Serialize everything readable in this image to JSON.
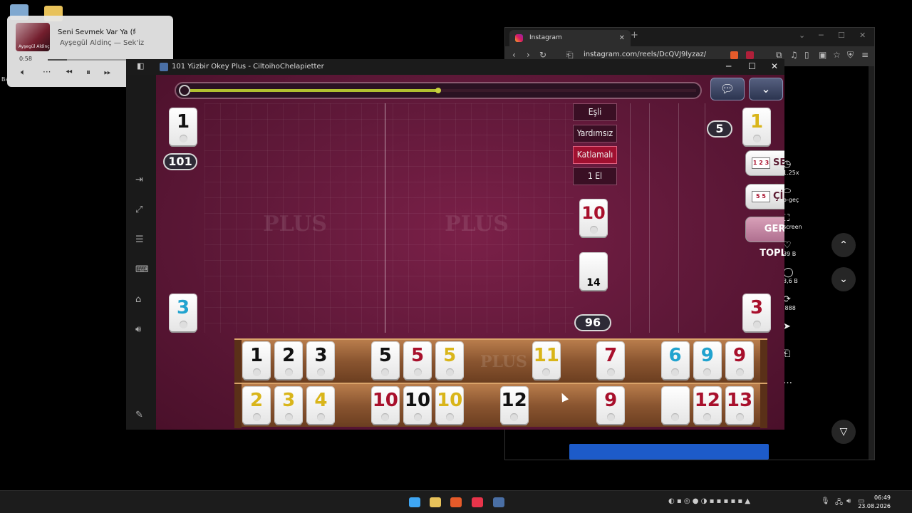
{
  "media": {
    "title": "Seni Sevmek Var Ya (fea",
    "artist": "Ayşegül Aldinç — Sek'iz",
    "art_text": "Ayşegül Aldinç",
    "elapsed": "0:58",
    "progress": 0.18
  },
  "desktop": {
    "label": "Ba"
  },
  "browser": {
    "tab_title": "Instagram",
    "url": "instagram.com/reels/DcQVJ9lyzaz/",
    "side": [
      {
        "glyph": "◷",
        "label": "1.25x"
      },
      {
        "glyph": "⬭",
        "label": "o-geç"
      },
      {
        "glyph": "⛶",
        "label": "screen"
      },
      {
        "glyph": "♡",
        "label": "39 B"
      },
      {
        "glyph": "◯",
        "label": "3,6 B"
      },
      {
        "glyph": "⟳",
        "label": ".888"
      },
      {
        "glyph": "➤",
        "label": ""
      },
      {
        "glyph": "⎗",
        "label": ""
      },
      {
        "glyph": "…",
        "label": ""
      }
    ]
  },
  "game": {
    "window_title": "101 Yüzbir Okey Plus - CiltoihoChelapietter",
    "watermark": "PLUS",
    "left_top_tile": {
      "value": "1",
      "color": "black"
    },
    "left_bottom_tile": {
      "value": "3",
      "color": "blue"
    },
    "right_top_tile": {
      "value": "1",
      "color": "yellow"
    },
    "right_bottom_tile": {
      "value": "3",
      "color": "red"
    },
    "score_left": "101",
    "score_right": "5",
    "deck_count": "96",
    "indicator_tile": {
      "value": "10",
      "color": "red"
    },
    "pile_count": "14",
    "tags": [
      {
        "label": "Eşli",
        "active": false
      },
      {
        "label": "Yardımsız",
        "active": false
      },
      {
        "label": "Katlamalı",
        "active": true
      },
      {
        "label": "1 El",
        "active": false
      }
    ],
    "buttons": {
      "seri_ac": "SERİ AÇ",
      "seri_cards": "1 2 3",
      "cift_ac": "ÇİFT AÇ",
      "cift_cards": "5 5",
      "geri_topla": "GERİ TOPLA"
    },
    "timer_progress": 0.49,
    "rack_top": [
      {
        "value": "1",
        "color": "black",
        "slot": 0
      },
      {
        "value": "2",
        "color": "black",
        "slot": 1
      },
      {
        "value": "3",
        "color": "black",
        "slot": 2
      },
      {
        "value": "5",
        "color": "black",
        "slot": 4
      },
      {
        "value": "5",
        "color": "red",
        "slot": 5
      },
      {
        "value": "5",
        "color": "yellow",
        "slot": 6
      },
      {
        "value": "11",
        "color": "yellow",
        "slot": 9
      },
      {
        "value": "7",
        "color": "red",
        "slot": 11
      },
      {
        "value": "6",
        "color": "blue",
        "slot": 13
      },
      {
        "value": "9",
        "color": "blue",
        "slot": 14
      },
      {
        "value": "9",
        "color": "red",
        "slot": 15
      }
    ],
    "rack_bottom": [
      {
        "value": "2",
        "color": "yellow",
        "slot": 0
      },
      {
        "value": "3",
        "color": "yellow",
        "slot": 1
      },
      {
        "value": "4",
        "color": "yellow",
        "slot": 2
      },
      {
        "value": "10",
        "color": "red",
        "slot": 4
      },
      {
        "value": "10",
        "color": "black",
        "slot": 5
      },
      {
        "value": "10",
        "color": "yellow",
        "slot": 6
      },
      {
        "value": "12",
        "color": "black",
        "slot": 8
      },
      {
        "value": "9",
        "color": "red",
        "slot": 11
      },
      {
        "value": "",
        "color": "black",
        "slot": 13
      },
      {
        "value": "12",
        "color": "red",
        "slot": 14
      },
      {
        "value": "13",
        "color": "red",
        "slot": 15
      }
    ]
  },
  "taskbar": {
    "time": "06:49",
    "date": "23.08.2026"
  }
}
